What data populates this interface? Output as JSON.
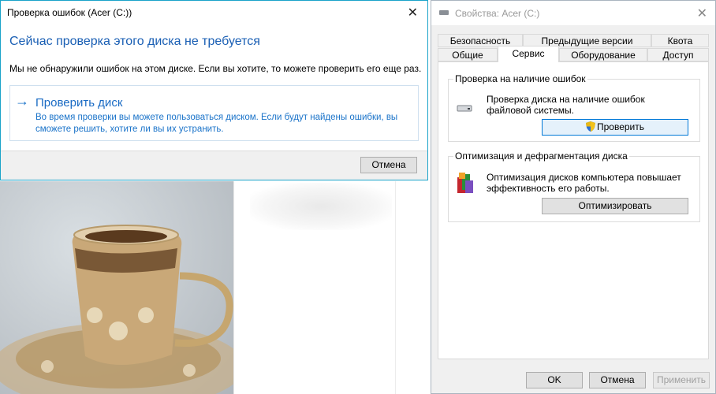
{
  "error_check_dialog": {
    "title": "Проверка ошибок (Acer (C:))",
    "heading": "Сейчас проверка этого диска не требуется",
    "message": "Мы не обнаружили ошибок на этом диске. Если вы хотите, то можете проверить его еще раз.",
    "action_label": "Проверить диск",
    "action_description": "Во время проверки вы можете пользоваться диском. Если будут найдены ошибки, вы сможете решить, хотите ли вы их устранить.",
    "cancel_label": "Отмена"
  },
  "properties_window": {
    "title": "Свойства: Acer (C:)",
    "tabs_row1": [
      "Безопасность",
      "Предыдущие версии",
      "Квота"
    ],
    "tabs_row2": [
      "Общие",
      "Сервис",
      "Оборудование",
      "Доступ"
    ],
    "active_tab": "Сервис",
    "error_check_group": {
      "legend": "Проверка на наличие ошибок",
      "text": "Проверка диска на наличие ошибок файловой системы.",
      "button": "Проверить"
    },
    "optimize_group": {
      "legend": "Оптимизация и дефрагментация диска",
      "text": "Оптимизация дисков компьютера повышает эффективность его работы.",
      "button": "Оптимизировать"
    },
    "buttons": {
      "ok": "OK",
      "cancel": "Отмена",
      "apply": "Применить"
    }
  },
  "colors": {
    "accent_blue": "#1a6bc4",
    "dialog_border": "#1aa3c9",
    "disabled_text": "#a0a0a0"
  }
}
